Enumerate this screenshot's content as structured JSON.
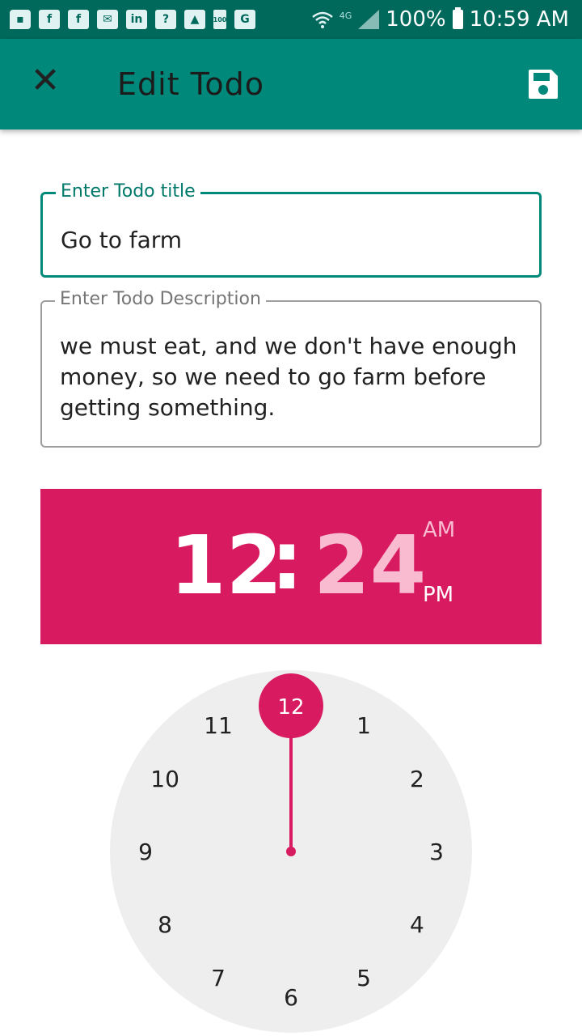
{
  "status_bar": {
    "battery_percent": "100%",
    "time": "10:59 AM",
    "network_label": "4G",
    "notification_icons": [
      "chat-icon",
      "facebook-icon",
      "facebook-icon",
      "mail-icon",
      "linkedin-icon",
      "help-icon",
      "image-icon",
      "battery-100-icon",
      "translate-icon"
    ]
  },
  "app_bar": {
    "close_glyph": "✕",
    "title": "Edit Todo",
    "save_icon": "save-icon"
  },
  "form": {
    "title_label": "Enter Todo title",
    "title_value": "Go to farm",
    "description_label": "Enter Todo Description",
    "description_value": "we must eat, and we don't have enough money, so we need to go farm before getting something."
  },
  "time_picker": {
    "hour": "12",
    "separator": ":",
    "minute": "24",
    "am_label": "AM",
    "pm_label": "PM",
    "selected_period": "PM",
    "dial_selected": "12",
    "dial_numbers": [
      "1",
      "2",
      "3",
      "4",
      "5",
      "6",
      "7",
      "8",
      "9",
      "10",
      "11"
    ],
    "accent_color": "#d81b60"
  },
  "colors": {
    "status_bar": "#00695c",
    "app_bar": "#00897b",
    "focused_field": "#00897b",
    "dial_face": "#eeeeee"
  }
}
